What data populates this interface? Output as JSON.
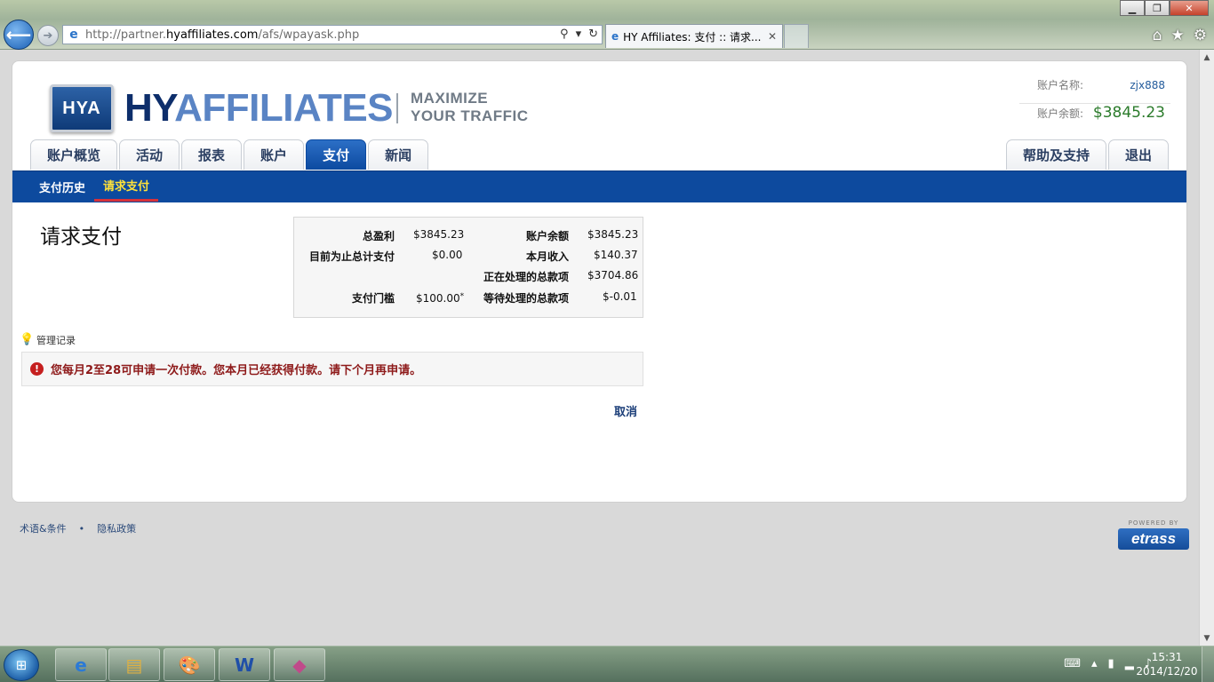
{
  "browser": {
    "url_prefix": "http://partner.",
    "url_host": "hyaffiliates.com",
    "url_path": "/afs/wpayask.php",
    "tab_title": "HY Affiliates: 支付 :: 请求...",
    "window_controls": {
      "minimize": "▁",
      "maximize": "❐",
      "close": "✕"
    }
  },
  "logo": {
    "badge": "HYA",
    "word_hy": "HY",
    "word_aff": "AFFILIATES",
    "tagline_1": "MAXIMIZE",
    "tagline_2": "YOUR TRAFFIC"
  },
  "account": {
    "name_label": "账户名称:",
    "name_value": "zjx888",
    "balance_label": "账户余额:",
    "balance_value": "$3845.23"
  },
  "tabs": [
    {
      "label": "账户概览",
      "active": false
    },
    {
      "label": "活动",
      "active": false
    },
    {
      "label": "报表",
      "active": false
    },
    {
      "label": "账户",
      "active": false
    },
    {
      "label": "支付",
      "active": true
    },
    {
      "label": "新闻",
      "active": false
    }
  ],
  "tabs_right": [
    {
      "label": "帮助及支持"
    },
    {
      "label": "退出"
    }
  ],
  "subnav": [
    {
      "label": "支付历史",
      "active": false
    },
    {
      "label": "请求支付",
      "active": true
    }
  ],
  "page": {
    "title": "请求支付",
    "summary": {
      "total_profit_label": "总盈利",
      "total_profit_value": "$3845.23",
      "account_balance_label": "账户余额",
      "account_balance_value": "$3845.23",
      "paid_to_date_label": "目前为止总计支付",
      "paid_to_date_value": "$0.00",
      "month_income_label": "本月收入",
      "month_income_value": "$140.37",
      "processing_label": "正在处理的总款项",
      "processing_value": "$3704.86",
      "threshold_label": "支付门槛",
      "threshold_value": "$100.00",
      "threshold_mark": "*",
      "pending_label": "等待处理的总款项",
      "pending_value": "$-0.01"
    },
    "note_label": "管理记录",
    "alert_text": "您每月2至28可申请一次付款。您本月已经获得付款。请下个月再申请。",
    "cancel_label": "取消"
  },
  "footer": {
    "terms": "术语&条件",
    "separator": "•",
    "privacy": "隐私政策",
    "powered_by": "POWERED BY",
    "brand": "etrass"
  },
  "taskbar": {
    "time": "15:31",
    "date": "2014/12/20"
  },
  "colors": {
    "nav_blue": "#0d4a9e",
    "active_subnav": "#ffe23a",
    "balance_green": "#2b7b2b",
    "alert_red": "#8e1a1a"
  }
}
